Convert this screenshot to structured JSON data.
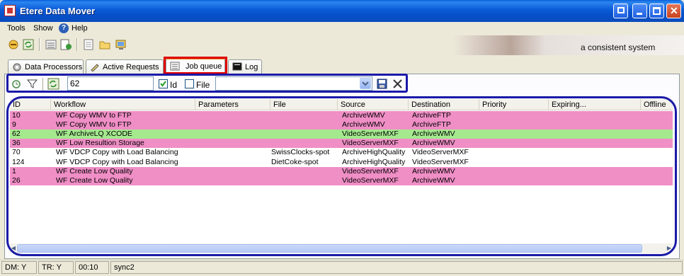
{
  "window": {
    "title": "Etere Data Mover"
  },
  "menu": {
    "tools": "Tools",
    "show": "Show",
    "help": "Help"
  },
  "banner": {
    "tagline": "a consistent system"
  },
  "tabs": [
    {
      "label": "Data Processors"
    },
    {
      "label": "Active Requests"
    },
    {
      "label": "Job queue"
    },
    {
      "label": "Log"
    }
  ],
  "filter": {
    "search_value": "62",
    "id_checked": true,
    "id_label": "Id",
    "file_checked": false,
    "file_label": "File",
    "combo_value": ""
  },
  "grid": {
    "columns": [
      "ID",
      "Workflow",
      "Parameters",
      "File",
      "Source",
      "Destination",
      "Priority",
      "Expiring...",
      "Offline"
    ],
    "rows": [
      {
        "id": "10",
        "workflow": "WF Copy WMV to FTP",
        "parameters": "",
        "file": "",
        "source": "ArchiveWMV",
        "destination": "ArchiveFTP",
        "color": "#f08ec6"
      },
      {
        "id": "9",
        "workflow": "WF Copy WMV to FTP",
        "parameters": "",
        "file": "",
        "source": "ArchiveWMV",
        "destination": "ArchiveFTP",
        "color": "#f08ec6"
      },
      {
        "id": "62",
        "workflow": "WF ArchiveLQ XCODE",
        "parameters": "",
        "file": "",
        "source": "VideoServerMXF",
        "destination": "ArchiveWMV",
        "color": "#a4e98e"
      },
      {
        "id": "36",
        "workflow": "WF Low Resultion Storage",
        "parameters": "",
        "file": "",
        "source": "VideoServerMXF",
        "destination": "ArchiveWMV",
        "color": "#f08ec6"
      },
      {
        "id": "70",
        "workflow": "WF VDCP Copy with Load Balancing",
        "parameters": "",
        "file": "SwissClocks-spot",
        "source": "ArchiveHighQuality",
        "destination": "VideoServerMXF",
        "color": "#ffffff"
      },
      {
        "id": "124",
        "workflow": "WF VDCP Copy with Load Balancing",
        "parameters": "",
        "file": "DietCoke-spot",
        "source": "ArchiveHighQuality",
        "destination": "VideoServerMXF",
        "color": "#ffffff"
      },
      {
        "id": "1",
        "workflow": "WF Create Low Quality",
        "parameters": "",
        "file": "",
        "source": "VideoServerMXF",
        "destination": "ArchiveWMV",
        "color": "#f08ec6"
      },
      {
        "id": "26",
        "workflow": "WF Create Low Quality",
        "parameters": "",
        "file": "",
        "source": "VideoServerMXF",
        "destination": "ArchiveWMV",
        "color": "#f08ec6"
      }
    ]
  },
  "status": {
    "dm": "DM: Y",
    "tr": "TR: Y",
    "time": "00:10",
    "sync": "sync2"
  }
}
